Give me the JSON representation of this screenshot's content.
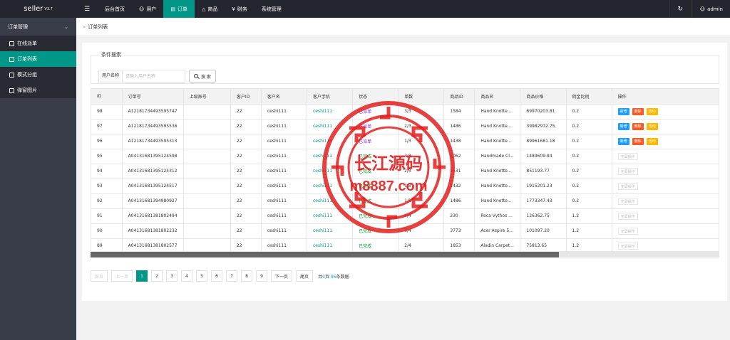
{
  "app": {
    "name": "seller",
    "version": "V3.7"
  },
  "topnav": {
    "items": [
      {
        "label": "后台首页",
        "icon": "",
        "active": false
      },
      {
        "label": "用户",
        "icon": "user-icon",
        "active": false
      },
      {
        "label": "订单",
        "icon": "document-icon",
        "active": true
      },
      {
        "label": "商品",
        "icon": "cart-icon",
        "active": false
      },
      {
        "label": "财务",
        "icon": "yen-icon",
        "active": false
      },
      {
        "label": "系统管理",
        "icon": "",
        "active": false
      }
    ],
    "user": "admin"
  },
  "sidebar": {
    "group": "订单管理",
    "items": [
      {
        "label": "在线派单",
        "icon": "edit-icon",
        "active": false
      },
      {
        "label": "订单列表",
        "icon": "list-icon",
        "active": true
      },
      {
        "label": "模式分组",
        "icon": "group-icon",
        "active": false
      },
      {
        "label": "弹窗图片",
        "icon": "image-icon",
        "active": false
      }
    ]
  },
  "breadcrumb": {
    "label": "订单列表"
  },
  "search": {
    "legend": "条件搜索",
    "field_label": "用户名称",
    "placeholder": "请输入用户名称",
    "button_label": "搜 索"
  },
  "table": {
    "columns": [
      "ID",
      "订单号",
      "上级账号",
      "客户ID",
      "客户名",
      "客户手机",
      "状态",
      "单数",
      "商品ID",
      "商品名",
      "商品价格",
      "佣金比例",
      "操作"
    ],
    "rows": [
      {
        "id": "98",
        "order": "A12181734493595747",
        "parent": "",
        "cid": "22",
        "cname": "ceshi111",
        "phone": "ceshi111",
        "status": "已派单",
        "count": "3/3",
        "pid": "1584",
        "pname": "Hand Knotte...",
        "price": "69970203.81",
        "rate": "0.2",
        "ops": "edit"
      },
      {
        "id": "97",
        "order": "A12181734493595536",
        "parent": "",
        "cid": "22",
        "cname": "ceshi111",
        "phone": "ceshi111",
        "status": "已派单",
        "count": "2/3",
        "pid": "1486",
        "pname": "Hand Knotte...",
        "price": "39982972.75",
        "rate": "0.2",
        "ops": "edit"
      },
      {
        "id": "96",
        "order": "A12181734493595313",
        "parent": "",
        "cid": "22",
        "cname": "ceshi111",
        "phone": "ceshi111",
        "status": "已派单",
        "count": "1/3",
        "pid": "1438",
        "pname": "Hand Knotte...",
        "price": "89961681.18",
        "rate": "0.2",
        "ops": "edit"
      },
      {
        "id": "95",
        "order": "A04131681395124598",
        "parent": "",
        "cid": "22",
        "cname": "ceshi111",
        "phone": "ceshi111",
        "status": "已完成",
        "count": "3/3",
        "pid": "1062",
        "pname": "Handmade Cl...",
        "price": "1489609.84",
        "rate": "0.2",
        "ops": "none"
      },
      {
        "id": "94",
        "order": "A04131681395124312",
        "parent": "",
        "cid": "22",
        "cname": "ceshi111",
        "phone": "ceshi111",
        "status": "已完成",
        "count": "2/3",
        "pid": "1531",
        "pname": "Hand Knotte...",
        "price": "851193.77",
        "rate": "0.2",
        "ops": "none"
      },
      {
        "id": "93",
        "order": "A04131681395124517",
        "parent": "",
        "cid": "22",
        "cname": "ceshi111",
        "phone": "ceshi111",
        "status": "已完成",
        "count": "1/3",
        "pid": "1432",
        "pname": "Hand Knotte...",
        "price": "1915201.23",
        "rate": "0.2",
        "ops": "none"
      },
      {
        "id": "92",
        "order": "A04131681394980927",
        "parent": "",
        "cid": "22",
        "cname": "ceshi111",
        "phone": "ceshi111",
        "status": "已完成",
        "count": "1/1",
        "pid": "1486",
        "pname": "Hand Knotte...",
        "price": "1773347.43",
        "rate": "0.2",
        "ops": "none"
      },
      {
        "id": "91",
        "order": "A04131681381802494",
        "parent": "",
        "cid": "22",
        "cname": "ceshi111",
        "phone": "ceshi111",
        "status": "已完成",
        "count": "4/4",
        "pid": "230",
        "pname": "Roca Vythos ...",
        "price": "126362.75",
        "rate": "1.2",
        "ops": "none"
      },
      {
        "id": "90",
        "order": "A04131681381802232",
        "parent": "",
        "cid": "22",
        "cname": "ceshi111",
        "phone": "ceshi111",
        "status": "已完成",
        "count": "3/4",
        "pid": "3773",
        "pname": "Acer Aspire 5 ...",
        "price": "101097.20",
        "rate": "1.2",
        "ops": "none"
      },
      {
        "id": "89",
        "order": "A04131681381802577",
        "parent": "",
        "cid": "22",
        "cname": "ceshi111",
        "phone": "ceshi111",
        "status": "已完成",
        "count": "2/4",
        "pid": "1853",
        "pname": "Aladin Carpet...",
        "price": "75813.65",
        "rate": "1.2",
        "ops": "none"
      }
    ],
    "op_labels": {
      "add": "新增",
      "delete": "删除",
      "activate": "活动",
      "none": "无需操作"
    }
  },
  "pagination": {
    "first": "首页",
    "prev": "上一页",
    "pages": [
      "1",
      "2",
      "3",
      "4",
      "5",
      "6",
      "7",
      "8",
      "9"
    ],
    "current": "1",
    "next": "下一页",
    "last": "尾页",
    "total_prefix": "共",
    "total_pages": "9",
    "total_mid": "页 ",
    "total_count": "86",
    "total_suffix": "条数据"
  },
  "watermark": {
    "title": "长江源码",
    "url": "m8887.com",
    "color": "#e02020"
  }
}
